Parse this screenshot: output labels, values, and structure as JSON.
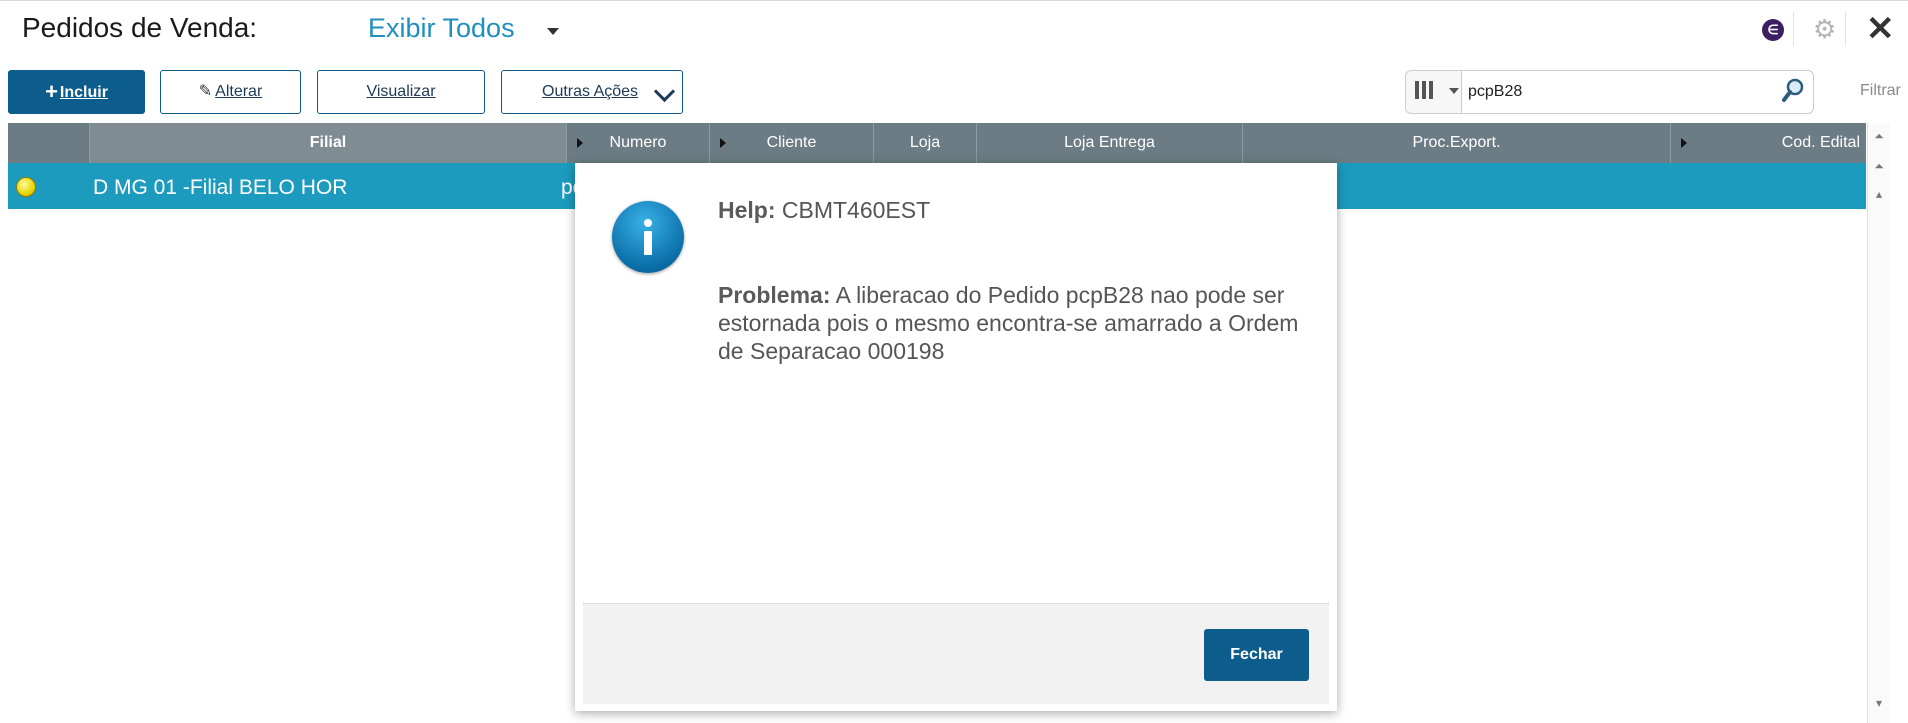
{
  "header": {
    "title": "Pedidos de Venda:",
    "view_select": "Exibir Todos",
    "icons": [
      "caret-down-icon",
      "app-e-icon",
      "gear-icon",
      "close-icon"
    ]
  },
  "toolbar": {
    "include_label": "Incluir",
    "alter_label": "Alterar",
    "view_label": "Visualizar",
    "more_label": "Outras Ações",
    "search_value": "pcpB28",
    "filter_label": "Filtrar"
  },
  "grid": {
    "columns": [
      "Filial",
      "Numero",
      "Cliente",
      "Loja",
      "Loja Entrega",
      "Proc.Export.",
      "Cod. Edital"
    ],
    "rows": [
      {
        "filial": "D MG 01 -Filial BELO HOR",
        "numero": "pc"
      }
    ],
    "selected_color": "#1c9bbf",
    "header_color": "#6c7c84"
  },
  "dialog": {
    "help_label": "Help:",
    "help_code": "CBMT460EST",
    "problem_label": "Problema:",
    "problem_text": "A liberacao do Pedido pcpB28 nao pode ser estornada pois o mesmo encontra-se amarrado a Ordem de Separacao 000198",
    "close_label": "Fechar"
  },
  "colors": {
    "primary": "#0c5d8c",
    "link": "#1f8fc0"
  }
}
